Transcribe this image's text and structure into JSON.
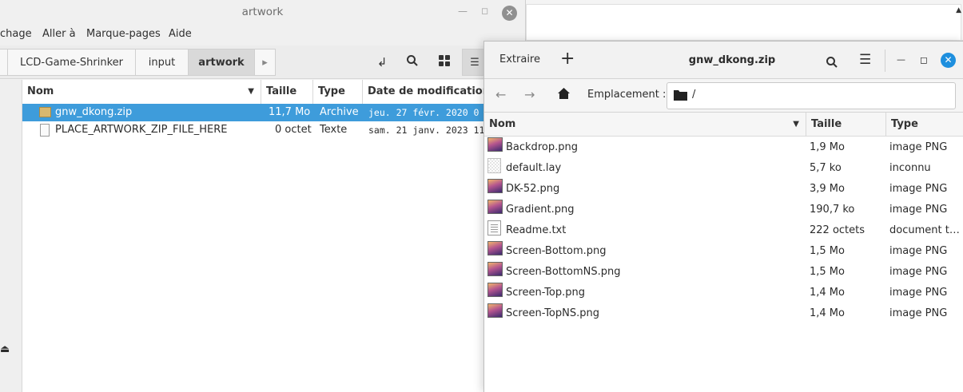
{
  "file_manager": {
    "title": "artwork",
    "menu": [
      "chage",
      "Aller à",
      "Marque-pages",
      "Aide"
    ],
    "breadcrumbs": [
      "LCD-Game-Shrinker",
      "input",
      "artwork"
    ],
    "columns": [
      "Nom",
      "Taille",
      "Type",
      "Date de modification"
    ],
    "files": [
      {
        "name": "gnw_dkong.zip",
        "size": "11,7 Mo",
        "type": "Archive",
        "date": "jeu. 27 févr. 2020 0",
        "selected": true,
        "icon": "zip-archive-icon"
      },
      {
        "name": "PLACE_ARTWORK_ZIP_FILE_HERE",
        "size": "0 octet",
        "type": "Texte",
        "date": "sam. 21 janv. 2023 11",
        "selected": false,
        "icon": "text-file-icon"
      }
    ]
  },
  "archive_manager": {
    "extract_label": "Extraire",
    "title": "gnw_dkong.zip",
    "location_label": "Emplacement :",
    "location_path": "/",
    "columns": [
      "Nom",
      "Taille",
      "Type"
    ],
    "files": [
      {
        "name": "Backdrop.png",
        "size": "1,9 Mo",
        "type": "image PNG",
        "icon": "png-image-icon"
      },
      {
        "name": "default.lay",
        "size": "5,7 ko",
        "type": "inconnu",
        "icon": "unknown-file-icon"
      },
      {
        "name": "DK-52.png",
        "size": "3,9 Mo",
        "type": "image PNG",
        "icon": "png-image-icon"
      },
      {
        "name": "Gradient.png",
        "size": "190,7 ko",
        "type": "image PNG",
        "icon": "png-image-icon"
      },
      {
        "name": "Readme.txt",
        "size": "222 octets",
        "type": "document te…",
        "icon": "text-file-icon"
      },
      {
        "name": "Screen-Bottom.png",
        "size": "1,5 Mo",
        "type": "image PNG",
        "icon": "png-image-icon"
      },
      {
        "name": "Screen-BottomNS.png",
        "size": "1,5 Mo",
        "type": "image PNG",
        "icon": "png-image-icon"
      },
      {
        "name": "Screen-Top.png",
        "size": "1,4 Mo",
        "type": "image PNG",
        "icon": "png-image-icon"
      },
      {
        "name": "Screen-TopNS.png",
        "size": "1,4 Mo",
        "type": "image PNG",
        "icon": "png-image-icon"
      }
    ]
  },
  "colors": {
    "selection": "#3e9cdb",
    "close_button": "#1e8fde"
  }
}
